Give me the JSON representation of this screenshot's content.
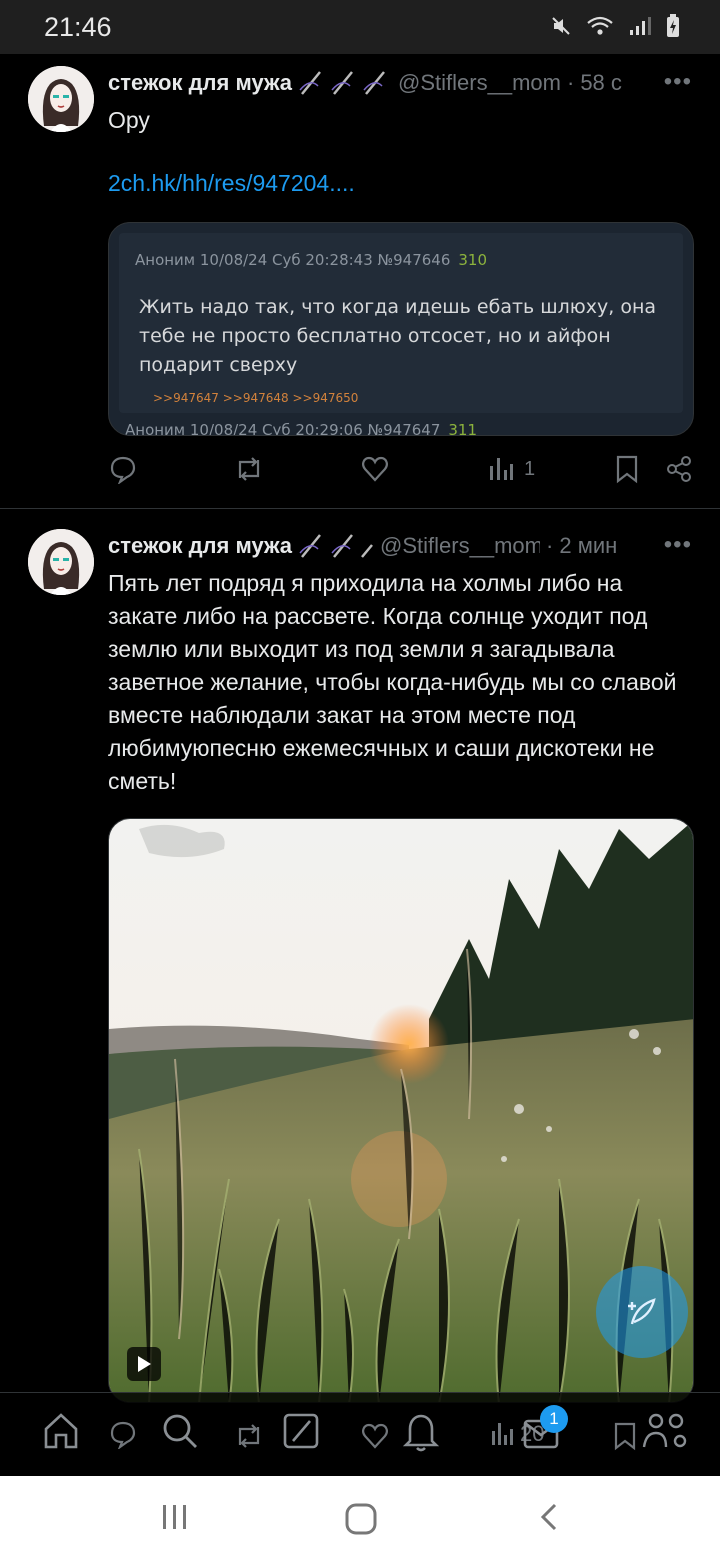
{
  "status_bar": {
    "time": "21:46"
  },
  "tweets": [
    {
      "author": "стежок для мужа",
      "handle": "@Stiflers__mom",
      "time": "58 с",
      "text": "Ору",
      "link": "2ch.hk/hh/res/947204....",
      "quote": {
        "header": "Аноним  10/08/24 Суб 20:28:43  №947646",
        "header_num": "310",
        "body": "Жить надо так, что когда идешь ебать шлюху, она тебе не просто бесплатно отсосет, но и айфон подарит сверху",
        "replies": ">>947647 >>947648 >>947650",
        "next_header": "Аноним  10/08/24 Суб 20:29:06  №947647",
        "next_num": "311"
      },
      "views": "1"
    },
    {
      "author": "стежок для мужа",
      "handle": "@Stiflers__mom",
      "time": "2 мин",
      "text": "Пять лет подряд я приходила на холмы либо на закате либо на рассвете. Когда солнце уходит под землю или выходит из под земли я загадывала заветное желание, чтобы когда-нибудь мы со славой вместе наблюдали закат на этом месте под любимуюпесню ежемесячных и саши дискотеки не сметь!"
    }
  ],
  "tabbar": {
    "views_count": "20",
    "notification_badge": "1"
  },
  "colors": {
    "accent": "#1d9bf0",
    "muted": "#71767b",
    "background": "#000000"
  }
}
